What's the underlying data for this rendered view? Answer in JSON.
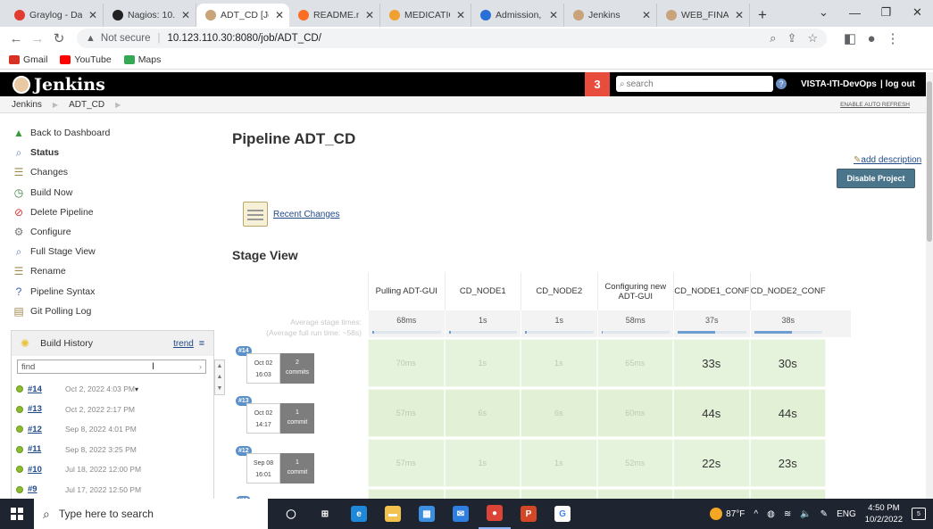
{
  "browser": {
    "tabs": [
      {
        "label": "Graylog - Da",
        "icon_color": "#e03c31",
        "icon": "graylog-icon",
        "active": false,
        "width": 110
      },
      {
        "label": "Nagios: 10.1",
        "icon_color": "#222222",
        "icon": "nagios-icon",
        "active": false,
        "width": 104
      },
      {
        "label": "ADT_CD [Jen",
        "icon_color": "#c9a37a",
        "icon": "jenkins-icon",
        "active": true,
        "width": 104
      },
      {
        "label": "README.md",
        "icon_color": "#fc6d26",
        "icon": "gitlab-icon",
        "active": false,
        "width": 102
      },
      {
        "label": "MEDICATION",
        "icon_color": "#f0a030",
        "icon": "medication-icon",
        "active": false,
        "width": 102
      },
      {
        "label": "Admission, Tr",
        "icon_color": "#2a6fd6",
        "icon": "admission-icon",
        "active": false,
        "width": 104
      },
      {
        "label": "Jenkins",
        "icon_color": "#c9a37a",
        "icon": "jenkins-icon",
        "active": false,
        "width": 104
      },
      {
        "label": "WEB_FINAL [",
        "icon_color": "#c9a37a",
        "icon": "jenkins-icon",
        "active": false,
        "width": 104
      }
    ],
    "security_label": "Not secure",
    "url": "10.123.110.30:8080/job/ADT_CD/",
    "bookmarks": [
      {
        "label": "Gmail",
        "color": "#d93025"
      },
      {
        "label": "YouTube",
        "color": "#ff0000"
      },
      {
        "label": "Maps",
        "color": "#34a853"
      }
    ]
  },
  "jenkins": {
    "brand": "Jenkins",
    "notification_count": "3",
    "search_placeholder": "search",
    "user": "VISTA-ITI-DevOps",
    "logout": "| log out",
    "breadcrumbs": [
      "Jenkins",
      "ADT_CD"
    ],
    "auto_refresh": "ENABLE AUTO REFRESH",
    "tasks": [
      {
        "label": "Back to Dashboard",
        "icon": "up-arrow-icon",
        "glyph": "▲",
        "color": "#3a9a3a"
      },
      {
        "label": "Status",
        "icon": "search-icon",
        "glyph": "⌕",
        "color": "#5b7fb5",
        "bold": true
      },
      {
        "label": "Changes",
        "icon": "notepad-icon",
        "glyph": "☰",
        "color": "#a08a50"
      },
      {
        "label": "Build Now",
        "icon": "clock-icon",
        "glyph": "◷",
        "color": "#3a7a3a"
      },
      {
        "label": "Delete Pipeline",
        "icon": "delete-icon",
        "glyph": "⊘",
        "color": "#d33"
      },
      {
        "label": "Configure",
        "icon": "gear-icon",
        "glyph": "⚙",
        "color": "#777"
      },
      {
        "label": "Full Stage View",
        "icon": "search-icon",
        "glyph": "⌕",
        "color": "#5b7fb5"
      },
      {
        "label": "Rename",
        "icon": "notepad-icon",
        "glyph": "☰",
        "color": "#a08a50"
      },
      {
        "label": "Pipeline Syntax",
        "icon": "help-icon",
        "glyph": "?",
        "color": "#3f64b0"
      },
      {
        "label": "Git Polling Log",
        "icon": "clipboard-icon",
        "glyph": "▤",
        "color": "#a08a50"
      }
    ],
    "build_history": {
      "title": "Build History",
      "trend": "trend",
      "trend_icon": "=",
      "find_placeholder": "find",
      "builds": [
        {
          "num": "#14",
          "date": "Oct 2, 2022 4:03 PM",
          "has_menu": true
        },
        {
          "num": "#13",
          "date": "Oct 2, 2022 2:17 PM"
        },
        {
          "num": "#12",
          "date": "Sep 8, 2022 4:01 PM"
        },
        {
          "num": "#11",
          "date": "Sep 8, 2022 3:25 PM"
        },
        {
          "num": "#10",
          "date": "Jul 18, 2022 12:00 PM"
        },
        {
          "num": "#9",
          "date": "Jul 17, 2022 12:50 PM"
        }
      ]
    },
    "page_title": "Pipeline ADT_CD",
    "add_description": "add description",
    "disable_project": "Disable Project",
    "recent_changes": "Recent Changes",
    "stage_view_title": "Stage View",
    "avg_label_line1": "Average stage times:",
    "avg_label_line2": "(Average full run time: ~58s)",
    "stages": [
      {
        "name": "Pulling ADT-GUI",
        "avg": "68ms",
        "avg_fraction": 0.02
      },
      {
        "name": "CD_NODE1",
        "avg": "1s",
        "avg_fraction": 0.03
      },
      {
        "name": "CD_NODE2",
        "avg": "1s",
        "avg_fraction": 0.03
      },
      {
        "name": "Configuring new ADT-GUI",
        "avg": "58ms",
        "avg_fraction": 0.02
      },
      {
        "name": "CD_NODE1_CONF",
        "avg": "37s",
        "avg_fraction": 0.55
      },
      {
        "name": "CD_NODE2_CONF",
        "avg": "38s",
        "avg_fraction": 0.56
      }
    ],
    "runs": [
      {
        "num": "#14",
        "month_day": "Oct 02",
        "time": "16:03",
        "commits_count": "2",
        "commits_label": "commits",
        "cells": [
          "70ms",
          "1s",
          "1s",
          "65ms",
          "33s",
          "30s"
        ]
      },
      {
        "num": "#13",
        "month_day": "Oct 02",
        "time": "14:17",
        "commits_count": "1",
        "commits_label": "commit",
        "cells": [
          "57ms",
          "6s",
          "6s",
          "60ms",
          "44s",
          "44s"
        ]
      },
      {
        "num": "#12",
        "month_day": "Sep 08",
        "time": "16:01",
        "commits_count": "1",
        "commits_label": "commit",
        "cells": [
          "57ms",
          "1s",
          "1s",
          "52ms",
          "22s",
          "23s"
        ]
      },
      {
        "num": "#11"
      }
    ]
  },
  "taskbar": {
    "search_placeholder": "Type here to search",
    "apps": [
      {
        "icon": "task-view-icon",
        "color": "transparent",
        "glyph": "◯"
      },
      {
        "icon": "multitask-icon",
        "color": "transparent",
        "glyph": "⊞"
      },
      {
        "icon": "edge-icon",
        "color": "#1f88d8",
        "glyph": "e"
      },
      {
        "icon": "file-explorer-icon",
        "color": "#f2c14e",
        "glyph": "▬"
      },
      {
        "icon": "store-icon",
        "color": "#3c8ee0",
        "glyph": "▦"
      },
      {
        "icon": "mail-icon",
        "color": "#2f7fe0",
        "glyph": "✉"
      },
      {
        "icon": "chrome-icon",
        "color": "#db4437",
        "glyph": "●",
        "active": true
      },
      {
        "icon": "powerpoint-icon",
        "color": "#d24726",
        "glyph": "P"
      },
      {
        "icon": "google-icon",
        "color": "#ffffff",
        "glyph": "G"
      }
    ],
    "temperature": "87°F",
    "language": "ENG",
    "time": "4:50 PM",
    "date": "10/2/2022",
    "notification_count": "5"
  }
}
